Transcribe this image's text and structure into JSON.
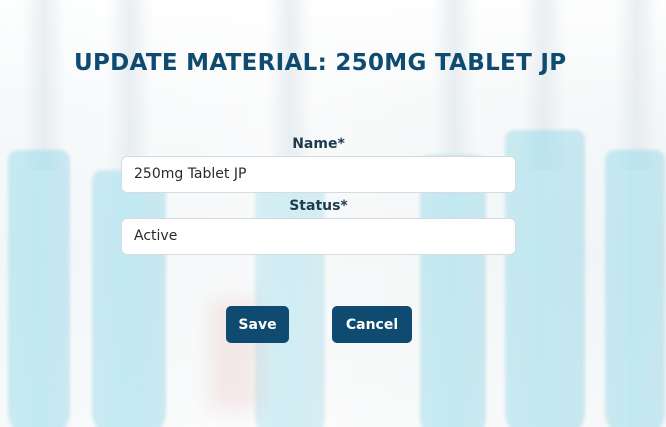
{
  "page": {
    "title": "UPDATE MATERIAL: 250MG TABLET JP"
  },
  "form": {
    "name_label": "Name*",
    "name_value": "250mg Tablet JP",
    "status_label": "Status*",
    "status_value": "Active"
  },
  "actions": {
    "save_label": "Save",
    "cancel_label": "Cancel"
  },
  "colors": {
    "primary": "#0f4a70",
    "title": "#0f4a70",
    "label": "#1e3a4f",
    "input_border": "#d5dbdf"
  }
}
